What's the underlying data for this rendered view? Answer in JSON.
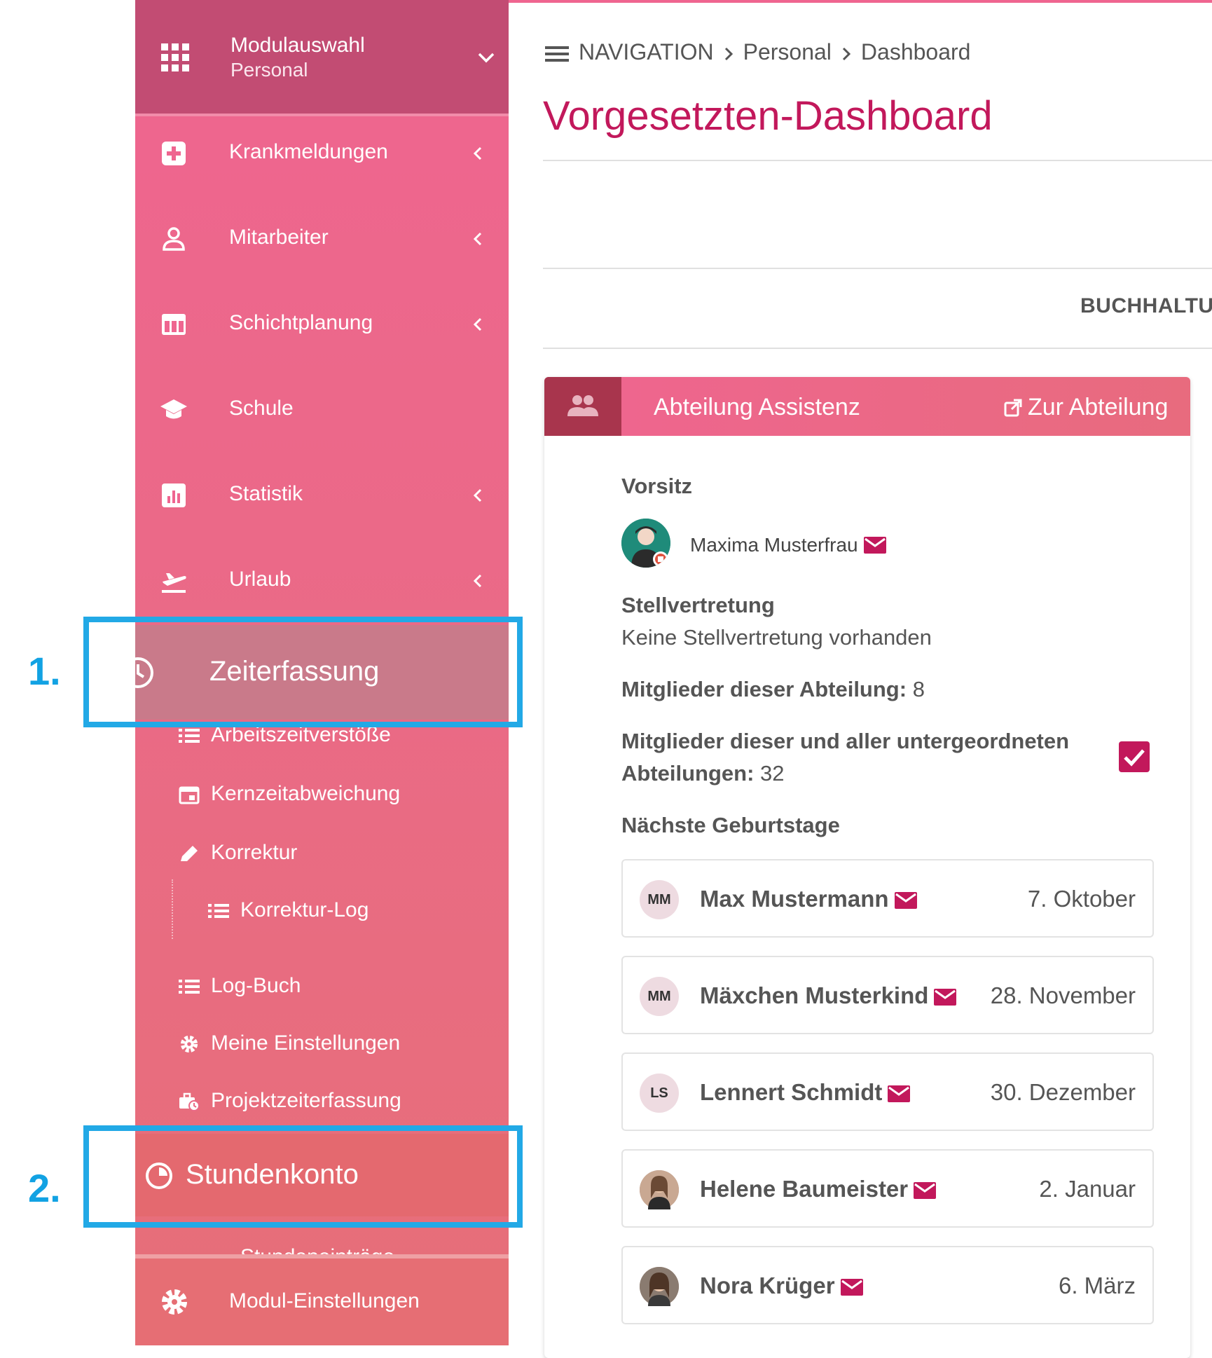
{
  "sidebar": {
    "module": {
      "title": "Modulauswahl",
      "subtitle": "Personal"
    },
    "items": [
      {
        "label": "Krankmeldungen",
        "icon": "medical-plus-icon"
      },
      {
        "label": "Mitarbeiter",
        "icon": "person-icon"
      },
      {
        "label": "Schichtplanung",
        "icon": "table-icon"
      },
      {
        "label": "Schule",
        "icon": "graduation-cap-icon"
      },
      {
        "label": "Statistik",
        "icon": "chart-icon"
      },
      {
        "label": "Urlaub",
        "icon": "plane-icon"
      }
    ],
    "active": {
      "label": "Zeiterfassung",
      "icon": "clock-icon"
    },
    "subitems": [
      {
        "label": "Arbeitszeitverstöße",
        "icon": "list-icon"
      },
      {
        "label": "Kernzeitabweichung",
        "icon": "calendar-icon"
      },
      {
        "label": "Korrektur",
        "icon": "pencil-icon"
      },
      {
        "label": "Korrektur-Log",
        "icon": "list-icon"
      },
      {
        "label": "Log-Buch",
        "icon": "list-icon"
      },
      {
        "label": "Meine Einstellungen",
        "icon": "gear-icon"
      },
      {
        "label": "Projektzeiterfassung",
        "icon": "briefcase-clock-icon"
      }
    ],
    "stundenkonto": {
      "label": "Stundenkonto",
      "icon": "pie-clock-icon"
    },
    "cut_label": "Stundeneinträge",
    "module_settings": {
      "label": "Modul-Einstellungen",
      "icon": "gear-icon"
    }
  },
  "annotations": {
    "step1": "1.",
    "step2": "2."
  },
  "breadcrumb": [
    "NAVIGATION",
    "Personal",
    "Dashboard"
  ],
  "page_title": "Vorgesetzten-Dashboard",
  "department_tab": "BUCHHALTU",
  "card": {
    "title": "Abteilung Assistenz",
    "link": "Zur Abteilung",
    "chair_label": "Vorsitz",
    "chair_name": "Maxima Musterfrau",
    "deputy_label": "Stellvertretung",
    "deputy_value": "Keine Stellvertretung vorhanden",
    "members_label": "Mitglieder dieser Abteilung:",
    "members_count": "8",
    "all_members_label_1": "Mitglieder dieser und aller untergeordneten",
    "all_members_label_2": "Abteilungen:",
    "all_members_count": "32",
    "birthdays_label": "Nächste Geburtstage",
    "birthdays": [
      {
        "initials": "MM",
        "name": "Max Mustermann",
        "date": "7. Oktober"
      },
      {
        "initials": "MM",
        "name": "Mäxchen Musterkind",
        "date": "28. November"
      },
      {
        "initials": "LS",
        "name": "Lennert Schmidt",
        "date": "30. Dezember"
      },
      {
        "initials": "",
        "name": "Helene Baumeister",
        "date": "2. Januar"
      },
      {
        "initials": "",
        "name": "Nora Krüger",
        "date": "6. März"
      }
    ]
  },
  "colors": {
    "accent": "#c2185b",
    "sidebar": "#ef6590",
    "highlight": "#22a9e6"
  }
}
